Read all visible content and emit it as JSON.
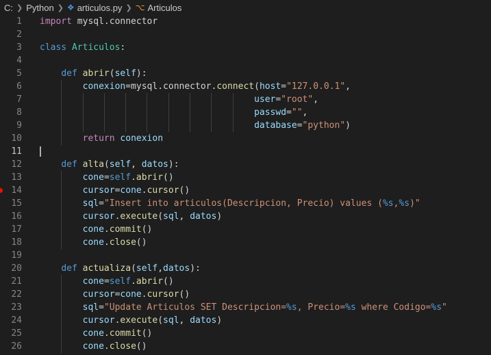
{
  "breadcrumb": {
    "drive": "C:",
    "folder": "Python",
    "file": "articulos.py",
    "symbol": "Articulos"
  },
  "editor": {
    "active_line": 11,
    "breakpoint_line": 14,
    "lines": [
      {
        "n": 1,
        "tokens": [
          [
            "kw",
            "import"
          ],
          [
            "pl",
            " mysql.connector"
          ]
        ]
      },
      {
        "n": 2,
        "tokens": []
      },
      {
        "n": 3,
        "tokens": [
          [
            "kw2",
            "class"
          ],
          [
            "pl",
            " "
          ],
          [
            "cls",
            "Articulos"
          ],
          [
            "pl",
            ":"
          ]
        ]
      },
      {
        "n": 4,
        "tokens": []
      },
      {
        "n": 5,
        "tokens": [
          [
            "pl",
            "    "
          ],
          [
            "kw2",
            "def"
          ],
          [
            "pl",
            " "
          ],
          [
            "fn",
            "abrir"
          ],
          [
            "pl",
            "("
          ],
          [
            "var",
            "self"
          ],
          [
            "pl",
            "):"
          ]
        ]
      },
      {
        "n": 6,
        "tokens": [
          [
            "pl",
            "        "
          ],
          [
            "var",
            "conexion"
          ],
          [
            "pl",
            "=mysql.connector."
          ],
          [
            "fn",
            "connect"
          ],
          [
            "pl",
            "("
          ],
          [
            "var",
            "host"
          ],
          [
            "pl",
            "="
          ],
          [
            "str",
            "\"127.0.0.1\""
          ],
          [
            "pl",
            ","
          ]
        ]
      },
      {
        "n": 7,
        "tokens": [
          [
            "pl",
            "                                        "
          ],
          [
            "var",
            "user"
          ],
          [
            "pl",
            "="
          ],
          [
            "str",
            "\"root\""
          ],
          [
            "pl",
            ","
          ]
        ]
      },
      {
        "n": 8,
        "tokens": [
          [
            "pl",
            "                                        "
          ],
          [
            "var",
            "passwd"
          ],
          [
            "pl",
            "="
          ],
          [
            "str",
            "\"\""
          ],
          [
            "pl",
            ","
          ]
        ]
      },
      {
        "n": 9,
        "tokens": [
          [
            "pl",
            "                                        "
          ],
          [
            "var",
            "database"
          ],
          [
            "pl",
            "="
          ],
          [
            "str",
            "\"python\""
          ],
          [
            "pl",
            ")"
          ]
        ]
      },
      {
        "n": 10,
        "tokens": [
          [
            "pl",
            "        "
          ],
          [
            "kw",
            "return"
          ],
          [
            "pl",
            " "
          ],
          [
            "var",
            "conexion"
          ]
        ]
      },
      {
        "n": 11,
        "tokens": []
      },
      {
        "n": 12,
        "tokens": [
          [
            "pl",
            "    "
          ],
          [
            "kw2",
            "def"
          ],
          [
            "pl",
            " "
          ],
          [
            "fn",
            "alta"
          ],
          [
            "pl",
            "("
          ],
          [
            "var",
            "self"
          ],
          [
            "pl",
            ", "
          ],
          [
            "var",
            "datos"
          ],
          [
            "pl",
            "):"
          ]
        ]
      },
      {
        "n": 13,
        "tokens": [
          [
            "pl",
            "        "
          ],
          [
            "var",
            "cone"
          ],
          [
            "pl",
            "="
          ],
          [
            "kw2",
            "self"
          ],
          [
            "pl",
            "."
          ],
          [
            "fn",
            "abrir"
          ],
          [
            "pl",
            "()"
          ]
        ]
      },
      {
        "n": 14,
        "tokens": [
          [
            "pl",
            "        "
          ],
          [
            "var",
            "cursor"
          ],
          [
            "pl",
            "="
          ],
          [
            "var",
            "cone"
          ],
          [
            "pl",
            "."
          ],
          [
            "fn",
            "cursor"
          ],
          [
            "pl",
            "()"
          ]
        ]
      },
      {
        "n": 15,
        "tokens": [
          [
            "pl",
            "        "
          ],
          [
            "var",
            "sql"
          ],
          [
            "pl",
            "="
          ],
          [
            "str",
            "\"Insert into articulos(Descripcion, Precio) values ("
          ],
          [
            "esc",
            "%s"
          ],
          [
            "str",
            ","
          ],
          [
            "esc",
            "%s"
          ],
          [
            "str",
            ")\""
          ]
        ]
      },
      {
        "n": 16,
        "tokens": [
          [
            "pl",
            "        "
          ],
          [
            "var",
            "cursor"
          ],
          [
            "pl",
            "."
          ],
          [
            "fn",
            "execute"
          ],
          [
            "pl",
            "("
          ],
          [
            "var",
            "sql"
          ],
          [
            "pl",
            ", "
          ],
          [
            "var",
            "datos"
          ],
          [
            "pl",
            ")"
          ]
        ]
      },
      {
        "n": 17,
        "tokens": [
          [
            "pl",
            "        "
          ],
          [
            "var",
            "cone"
          ],
          [
            "pl",
            "."
          ],
          [
            "fn",
            "commit"
          ],
          [
            "pl",
            "()"
          ]
        ]
      },
      {
        "n": 18,
        "tokens": [
          [
            "pl",
            "        "
          ],
          [
            "var",
            "cone"
          ],
          [
            "pl",
            "."
          ],
          [
            "fn",
            "close"
          ],
          [
            "pl",
            "()"
          ]
        ]
      },
      {
        "n": 19,
        "tokens": []
      },
      {
        "n": 20,
        "tokens": [
          [
            "pl",
            "    "
          ],
          [
            "kw2",
            "def"
          ],
          [
            "pl",
            " "
          ],
          [
            "fn",
            "actualiza"
          ],
          [
            "pl",
            "("
          ],
          [
            "var",
            "self"
          ],
          [
            "pl",
            ","
          ],
          [
            "var",
            "datos"
          ],
          [
            "pl",
            "):"
          ]
        ]
      },
      {
        "n": 21,
        "tokens": [
          [
            "pl",
            "        "
          ],
          [
            "var",
            "cone"
          ],
          [
            "pl",
            "="
          ],
          [
            "kw2",
            "self"
          ],
          [
            "pl",
            "."
          ],
          [
            "fn",
            "abrir"
          ],
          [
            "pl",
            "()"
          ]
        ]
      },
      {
        "n": 22,
        "tokens": [
          [
            "pl",
            "        "
          ],
          [
            "var",
            "cursor"
          ],
          [
            "pl",
            "="
          ],
          [
            "var",
            "cone"
          ],
          [
            "pl",
            "."
          ],
          [
            "fn",
            "cursor"
          ],
          [
            "pl",
            "()"
          ]
        ]
      },
      {
        "n": 23,
        "tokens": [
          [
            "pl",
            "        "
          ],
          [
            "var",
            "sql"
          ],
          [
            "pl",
            "="
          ],
          [
            "str",
            "\"Update Articulos SET Descripcion="
          ],
          [
            "esc",
            "%s"
          ],
          [
            "str",
            ", Precio="
          ],
          [
            "esc",
            "%s"
          ],
          [
            "str",
            " where Codigo="
          ],
          [
            "esc",
            "%s"
          ],
          [
            "str",
            "\""
          ]
        ]
      },
      {
        "n": 24,
        "tokens": [
          [
            "pl",
            "        "
          ],
          [
            "var",
            "cursor"
          ],
          [
            "pl",
            "."
          ],
          [
            "fn",
            "execute"
          ],
          [
            "pl",
            "("
          ],
          [
            "var",
            "sql"
          ],
          [
            "pl",
            ", "
          ],
          [
            "var",
            "datos"
          ],
          [
            "pl",
            ")"
          ]
        ]
      },
      {
        "n": 25,
        "tokens": [
          [
            "pl",
            "        "
          ],
          [
            "var",
            "cone"
          ],
          [
            "pl",
            "."
          ],
          [
            "fn",
            "commit"
          ],
          [
            "pl",
            "()"
          ]
        ]
      },
      {
        "n": 26,
        "tokens": [
          [
            "pl",
            "        "
          ],
          [
            "var",
            "cone"
          ],
          [
            "pl",
            "."
          ],
          [
            "fn",
            "close"
          ],
          [
            "pl",
            "()"
          ]
        ]
      }
    ]
  }
}
